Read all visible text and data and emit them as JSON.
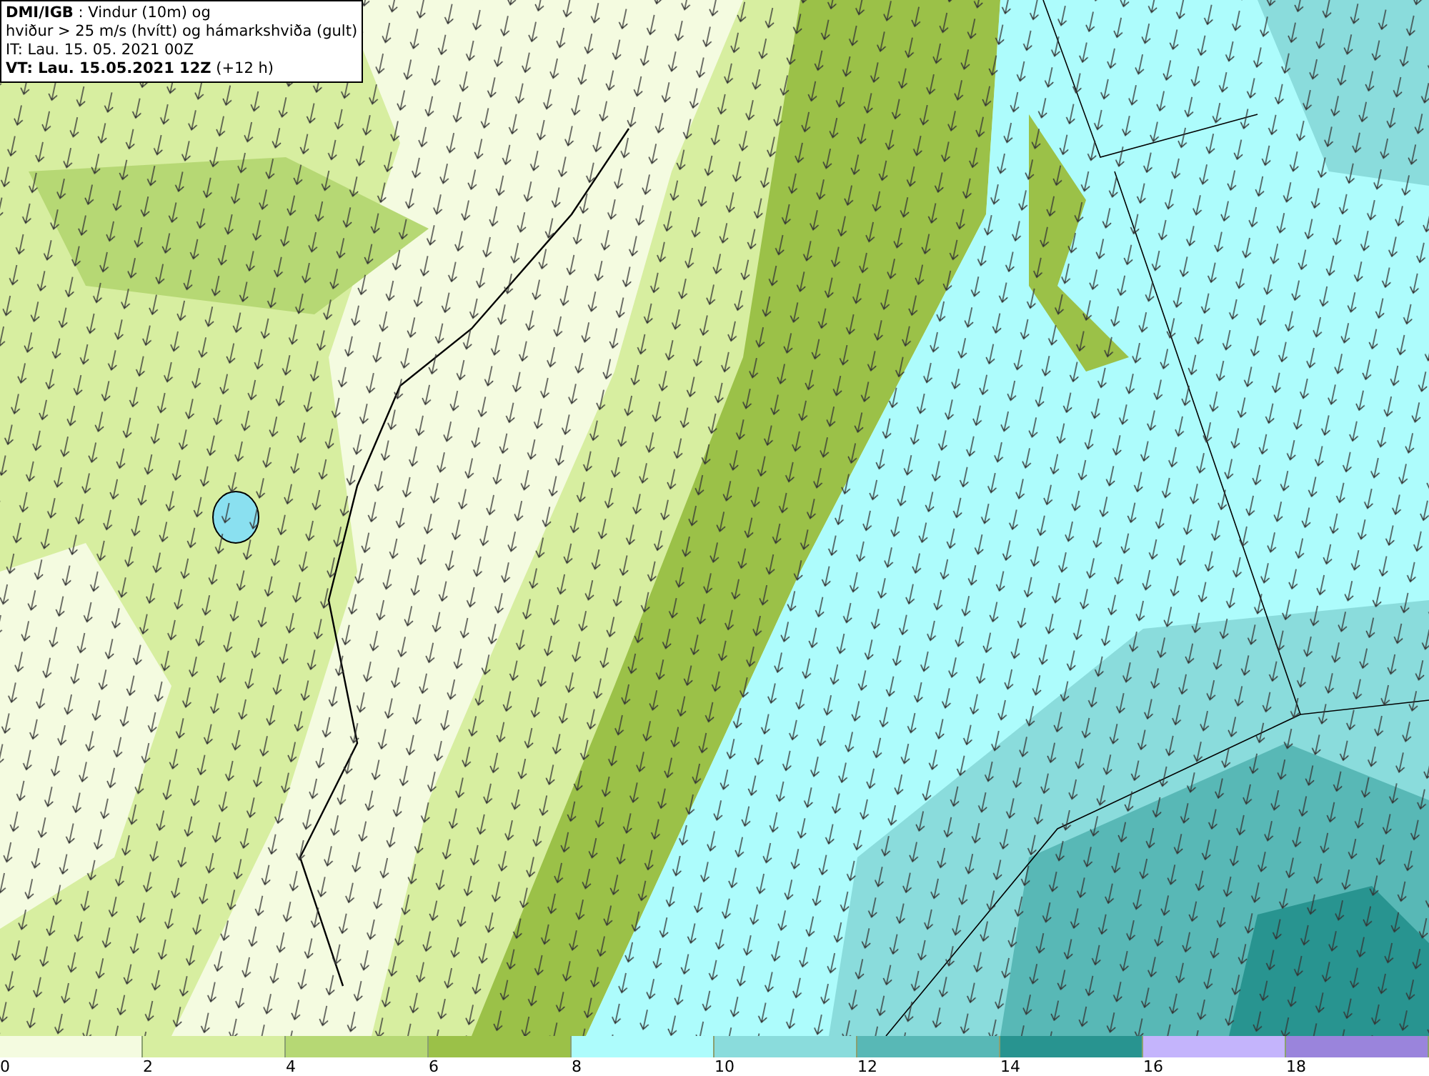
{
  "caption": {
    "lines": [
      "**DMI/IGB** : Vindur (10m) og",
      "hviður > 25 m/s (hvítt) og hámarkshviða (gult)",
      "IT: Lau. 15. 05. 2021 00Z",
      "**VT: Lau. 15.05.2021 12Z** (+12 h)"
    ]
  },
  "legend": [
    {
      "label": "0",
      "color": "#f4fbe0"
    },
    {
      "label": "2",
      "color": "#d7eea0"
    },
    {
      "label": "4",
      "color": "#b6d874"
    },
    {
      "label": "6",
      "color": "#9bc148"
    },
    {
      "label": "8",
      "color": "#adfcfc"
    },
    {
      "label": "10",
      "color": "#8adcdc"
    },
    {
      "label": "12",
      "color": "#58b8b6"
    },
    {
      "label": "14",
      "color": "#289490"
    },
    {
      "label": "16",
      "color": "#c4b4fc"
    },
    {
      "label": "18",
      "color": "#9a84dc"
    }
  ]
}
